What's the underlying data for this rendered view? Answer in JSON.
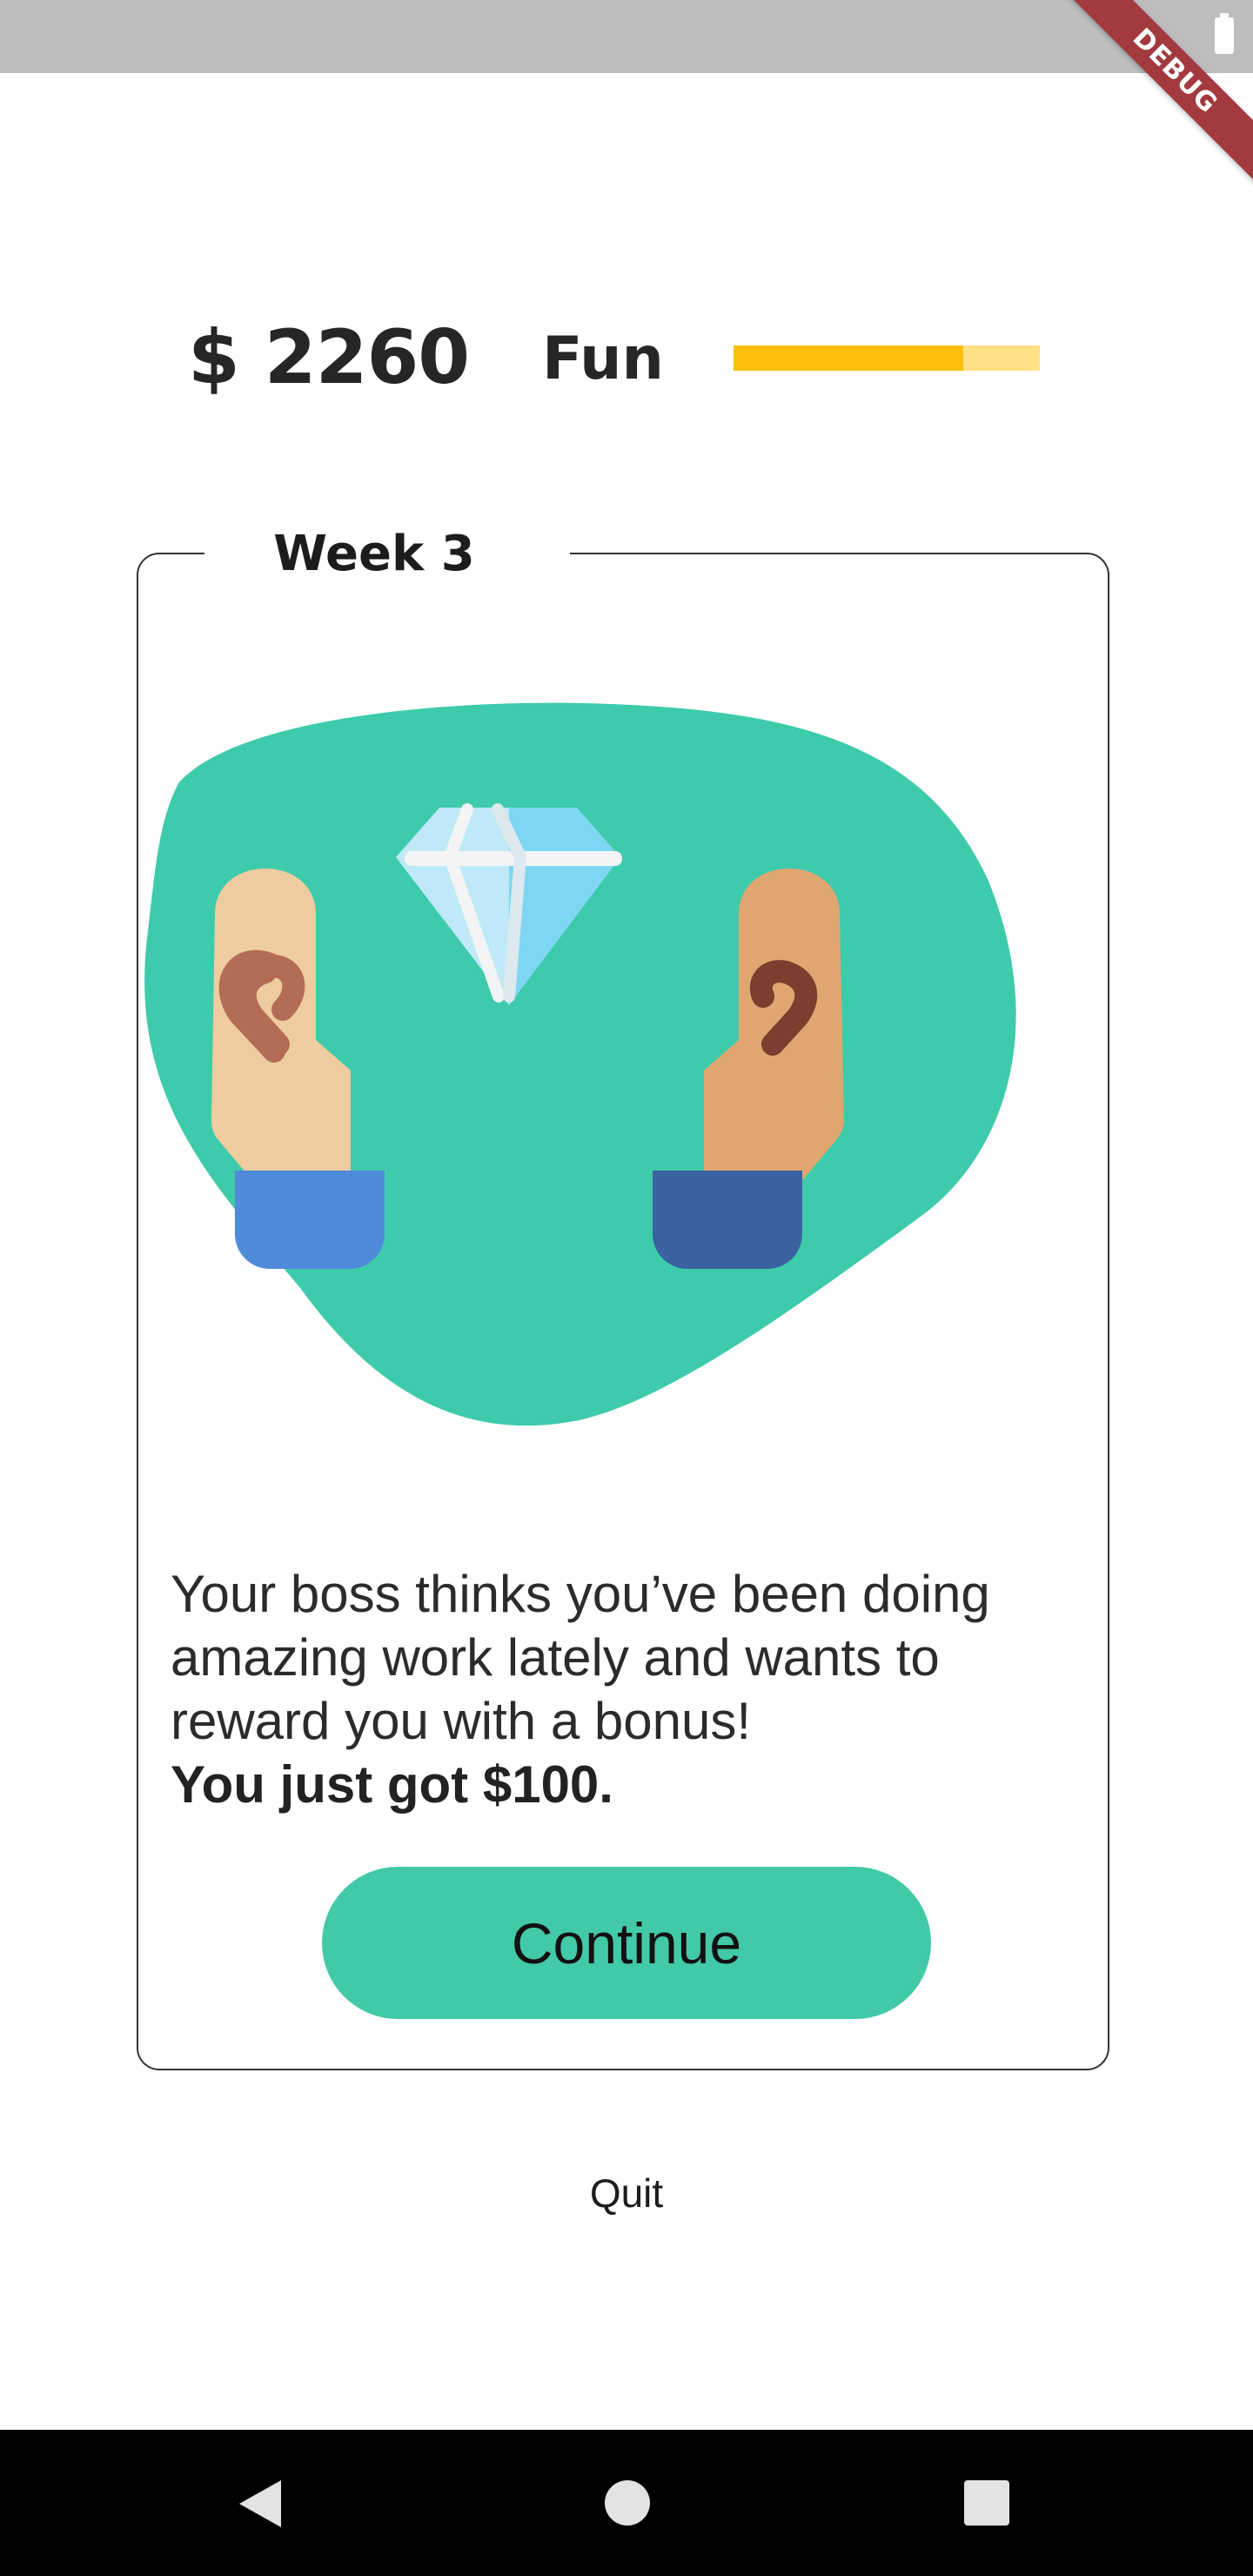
{
  "status_bar": {
    "debug_label": "DEBUG"
  },
  "stats": {
    "money": "$ 2260",
    "fun_label": "Fun",
    "fun_level_percent": 75,
    "fun_fill_color": "#fbbf0e",
    "fun_track_color": "#ffe083"
  },
  "card": {
    "week_label": "Week 3",
    "message_lines": [
      "Your boss thinks you’ve been doing",
      "amazing work lately and wants to",
      "reward you with a bonus!"
    ],
    "highlight": "You just got $100.",
    "continue_label": "Continue",
    "accent_color": "#42c9a8"
  },
  "quit_label": "Quit",
  "illustration": {
    "icon": "hands-holding-diamond-icon",
    "blob_color": "#3ecbab"
  }
}
